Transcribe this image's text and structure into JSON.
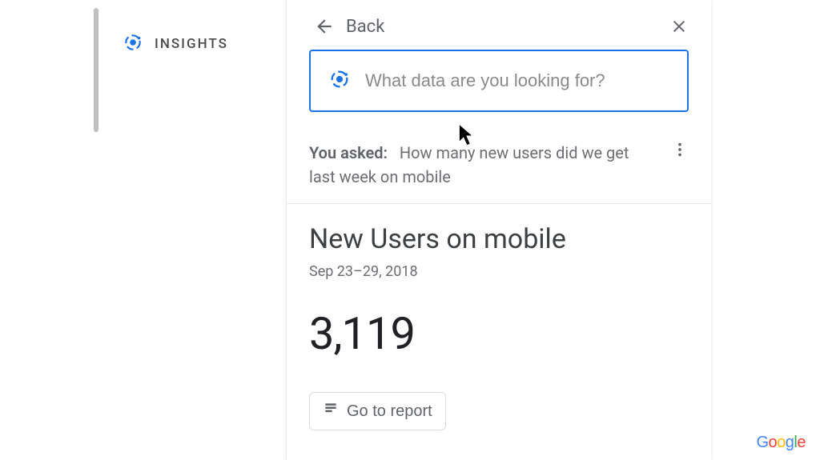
{
  "sidebar": {
    "label": "INSIGHTS"
  },
  "header": {
    "back_label": "Back"
  },
  "search": {
    "placeholder": "What data are you looking for?",
    "value": ""
  },
  "asked": {
    "prefix": "You asked:",
    "question": "How many new users did we get last week on mobile"
  },
  "result": {
    "title": "New Users on mobile",
    "date_range": "Sep 23–29, 2018",
    "value": "3,119",
    "report_button": "Go to report"
  },
  "footer": {
    "brand": "Google"
  }
}
